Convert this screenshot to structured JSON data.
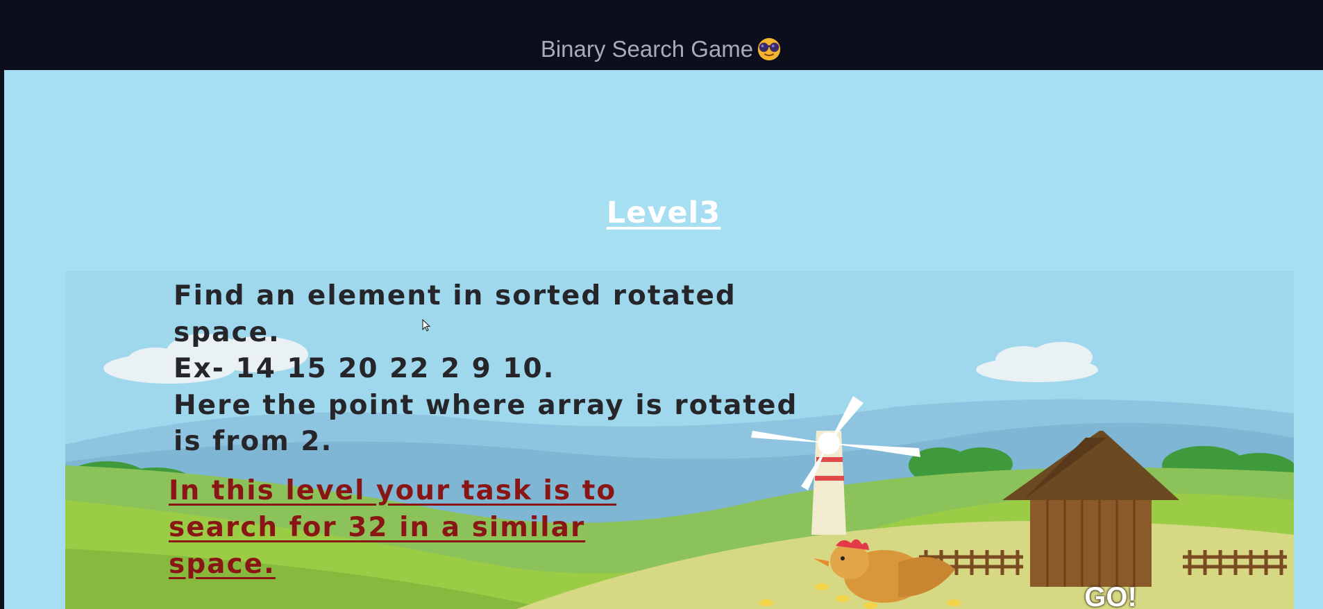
{
  "app": {
    "title": "Binary Search Game",
    "title_emoji": "smiling-face-with-sunglasses-icon"
  },
  "level": {
    "title": "Level3"
  },
  "description": {
    "lines": [
      "Find an element in sorted rotated",
      "space.",
      "Ex- 14 15 20 22 2 9 10.",
      "Here the point where array is rotated",
      "is from 2."
    ]
  },
  "task": {
    "lines": [
      "In this level your task is to",
      "search for 32 in a similar",
      "space."
    ]
  },
  "controls": {
    "go_label": "GO!"
  },
  "colors": {
    "topbar": "#0c0e1c",
    "background": "#a6dff1",
    "task_text": "#8a1515",
    "body_text": "#26262a",
    "title_text": "#ffffff"
  }
}
